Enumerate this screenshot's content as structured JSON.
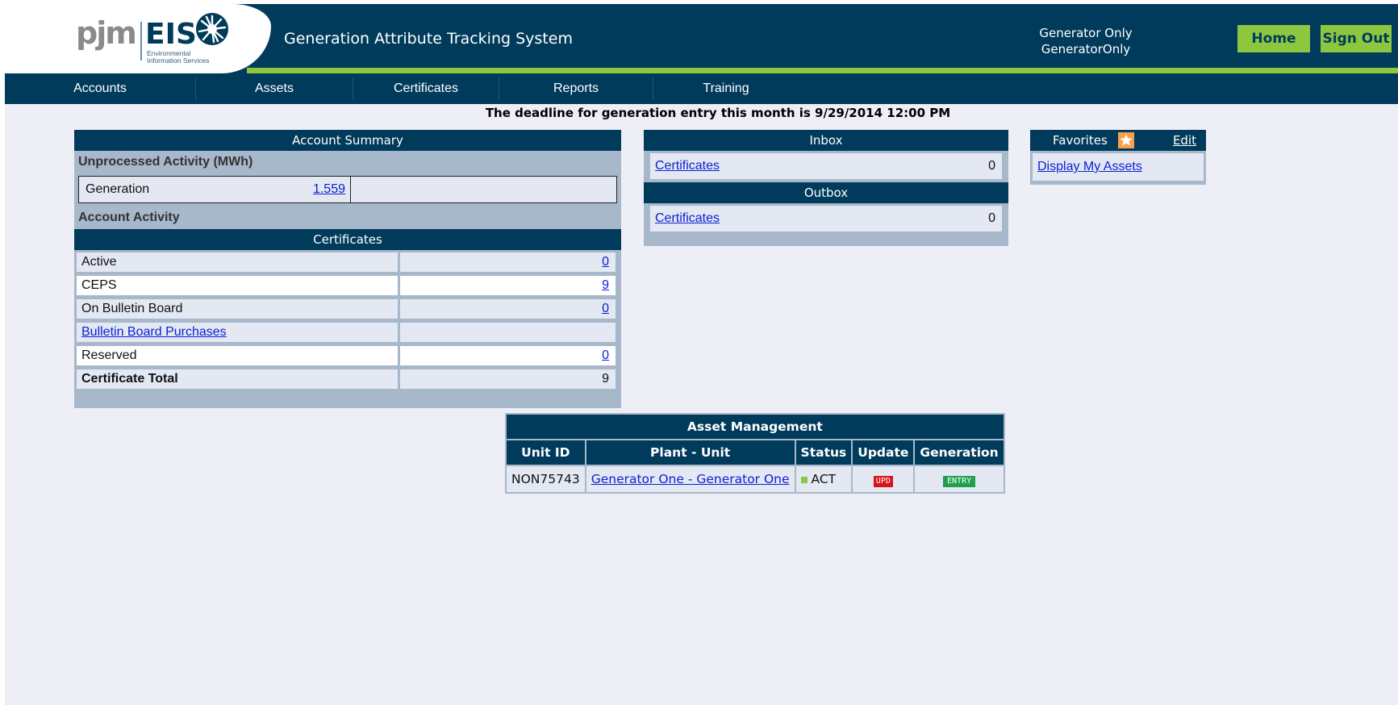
{
  "header": {
    "logo_text": "pjm",
    "logo_eis": "EIS",
    "logo_sub1": "Environmental",
    "logo_sub2": "Information Services",
    "title": "Generation Attribute Tracking System",
    "user_line1": "Generator Only",
    "user_line2": "GeneratorOnly",
    "home_label": "Home",
    "signout_label": "Sign Out",
    "accent_color": "#8dc63f",
    "brand_color": "#003b5c"
  },
  "nav": {
    "items": [
      {
        "label": "Accounts"
      },
      {
        "label": "Assets"
      },
      {
        "label": "Certificates"
      },
      {
        "label": "Reports"
      },
      {
        "label": "Training"
      }
    ]
  },
  "deadline": "The deadline for generation entry this month is 9/29/2014 12:00 PM",
  "account_summary": {
    "title": "Account Summary",
    "unprocessed_label": "Unprocessed Activity (MWh)",
    "generation_label": "Generation",
    "generation_value": "1.559",
    "activity_label": "Account Activity",
    "certificates_title": "Certificates",
    "rows": [
      {
        "label": "Active",
        "value": "0"
      },
      {
        "label": "CEPS",
        "value": "9"
      },
      {
        "label": "On Bulletin Board",
        "value": "0"
      },
      {
        "label": "Bulletin Board Purchases",
        "value": ""
      },
      {
        "label": "Reserved",
        "value": "0"
      },
      {
        "label": "Certificate Total",
        "value": "9"
      }
    ]
  },
  "inbox": {
    "title": "Inbox",
    "label": "Certificates",
    "count": "0"
  },
  "outbox": {
    "title": "Outbox",
    "label": "Certificates",
    "count": "0"
  },
  "favorites": {
    "title": "Favorites",
    "star_icon": "star-icon",
    "edit_label": "Edit",
    "link": "Display My Assets"
  },
  "asset_management": {
    "title": "Asset Management",
    "columns": [
      "Unit ID",
      "Plant - Unit",
      "Status",
      "Update",
      "Generation"
    ],
    "rows": [
      {
        "unit_id": "NON75743",
        "plant_unit": "Generator One - Generator One",
        "status": "ACT",
        "status_color": "#8dc63f",
        "update": "UPD",
        "update_color": "#d9121b",
        "generation": "ENTRY",
        "generation_color": "#1fa04a"
      }
    ]
  }
}
